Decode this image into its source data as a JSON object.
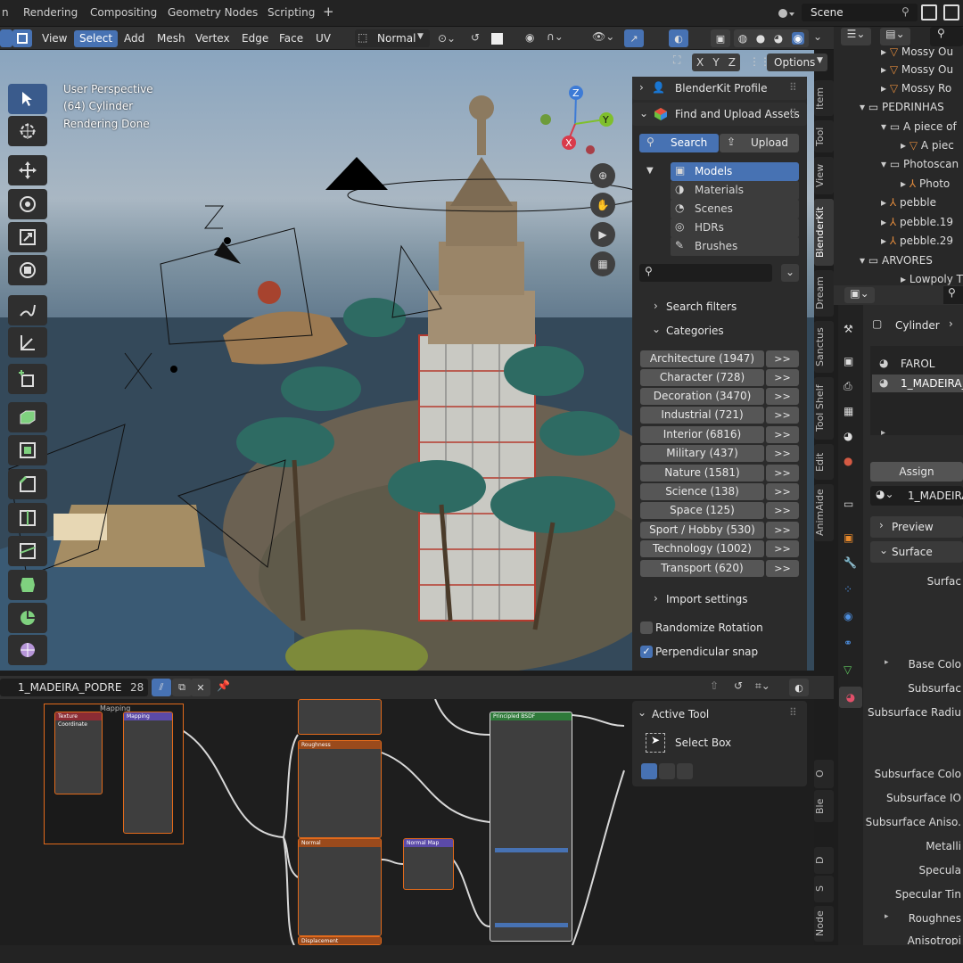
{
  "workspaces": [
    "n",
    "Rendering",
    "Compositing",
    "Geometry Nodes",
    "Scripting"
  ],
  "scene_name": "Scene",
  "viewport_header": {
    "menus": [
      "View",
      "Select",
      "Add",
      "Mesh",
      "Vertex",
      "Edge",
      "Face",
      "UV"
    ],
    "orientation": "Normal",
    "axes": [
      "X",
      "Y",
      "Z"
    ],
    "options": "Options"
  },
  "viewport_info": {
    "perspective": "User Perspective",
    "object": "(64) Cylinder",
    "status": "Rendering Done"
  },
  "blenderkit": {
    "profile": "BlenderKit Profile",
    "find": "Find and Upload Assets",
    "search_tab": "Search",
    "upload_tab": "Upload",
    "asset_types": [
      "Models",
      "Materials",
      "Scenes",
      "HDRs",
      "Brushes"
    ],
    "search_filters": "Search filters",
    "categories_label": "Categories",
    "categories": [
      "Architecture (1947)",
      "Character (728)",
      "Decoration (3470)",
      "Industrial (721)",
      "Interior (6816)",
      "Military (437)",
      "Nature (1581)",
      "Science (138)",
      "Space (125)",
      "Sport / Hobby (530)",
      "Technology (1002)",
      "Transport (620)"
    ],
    "go_label": ">>",
    "import_settings": "Import settings",
    "randomize_rotation": "Randomize Rotation",
    "perpendicular_snap": "Perpendicular snap",
    "perpendicular_checked": true,
    "randomize_checked": false
  },
  "side_tabs": [
    "Item",
    "Tool",
    "View",
    "BlenderKit",
    "Dream",
    "Sanctus",
    "Tool Shelf",
    "Edit",
    "AnimAide"
  ],
  "node_side_tabs": [
    "O",
    "Ble",
    "D",
    "S",
    "Node"
  ],
  "outliner": {
    "items": [
      "Mossy Ou",
      "Mossy Ou",
      "Mossy Ro",
      "PEDRINHAS",
      "A piece of",
      "A piec",
      "Photoscan",
      "Photo",
      "pebble",
      "pebble.19",
      "pebble.29",
      "ARVORES",
      "Lowpoly T"
    ]
  },
  "properties": {
    "object": "Cylinder",
    "materials": [
      "FAROL",
      "1_MADEIRA_P"
    ],
    "assign": "Assign",
    "material": "1_MADEIRA",
    "preview": "Preview",
    "surface": "Surface",
    "fields": [
      "Surfac",
      "Base Colo",
      "Subsurfac",
      "Subsurface Radiu",
      "Subsurface Colo",
      "Subsurface IO",
      "Subsurface Aniso.",
      "Metalli",
      "Specula",
      "Specular Tin",
      "Roughnes",
      "Anisotropi"
    ]
  },
  "node_editor": {
    "material": "1_MADEIRA_PODRE",
    "users": "28",
    "frame_label": "Mapping",
    "active_tool": "Active Tool",
    "select_box": "Select Box",
    "nodes": {
      "tex_coord": "Texture Coordinate",
      "mapping": "Mapping",
      "roughness": "Roughness",
      "normal": "Normal",
      "normal_map": "Normal Map",
      "principled": "Principled BSDF",
      "displacement": "Displacement"
    }
  }
}
